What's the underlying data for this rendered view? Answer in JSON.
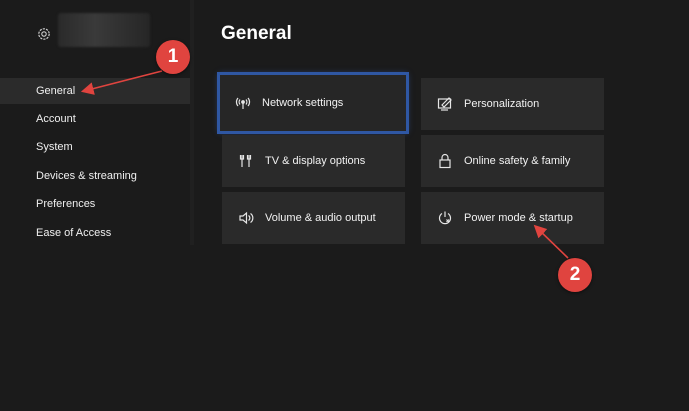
{
  "sidebar": {
    "items": [
      {
        "label": "General"
      },
      {
        "label": "Account"
      },
      {
        "label": "System"
      },
      {
        "label": "Devices & streaming"
      },
      {
        "label": "Preferences"
      },
      {
        "label": "Ease of Access"
      }
    ]
  },
  "main": {
    "title": "General",
    "tiles": [
      {
        "label": "Network settings",
        "icon": "network-icon"
      },
      {
        "label": "Personalization",
        "icon": "personalization-icon"
      },
      {
        "label": "TV & display options",
        "icon": "tv-display-icon"
      },
      {
        "label": "Online safety & family",
        "icon": "lock-icon"
      },
      {
        "label": "Volume & audio output",
        "icon": "speaker-icon"
      },
      {
        "label": "Power mode & startup",
        "icon": "power-mode-icon"
      }
    ]
  },
  "annotations": [
    {
      "number": "1"
    },
    {
      "number": "2"
    }
  ],
  "colors": {
    "background": "#1b1b1b",
    "tile": "#2a2a2a",
    "focus_outline": "#2f57a3",
    "badge": "#e0443f"
  }
}
